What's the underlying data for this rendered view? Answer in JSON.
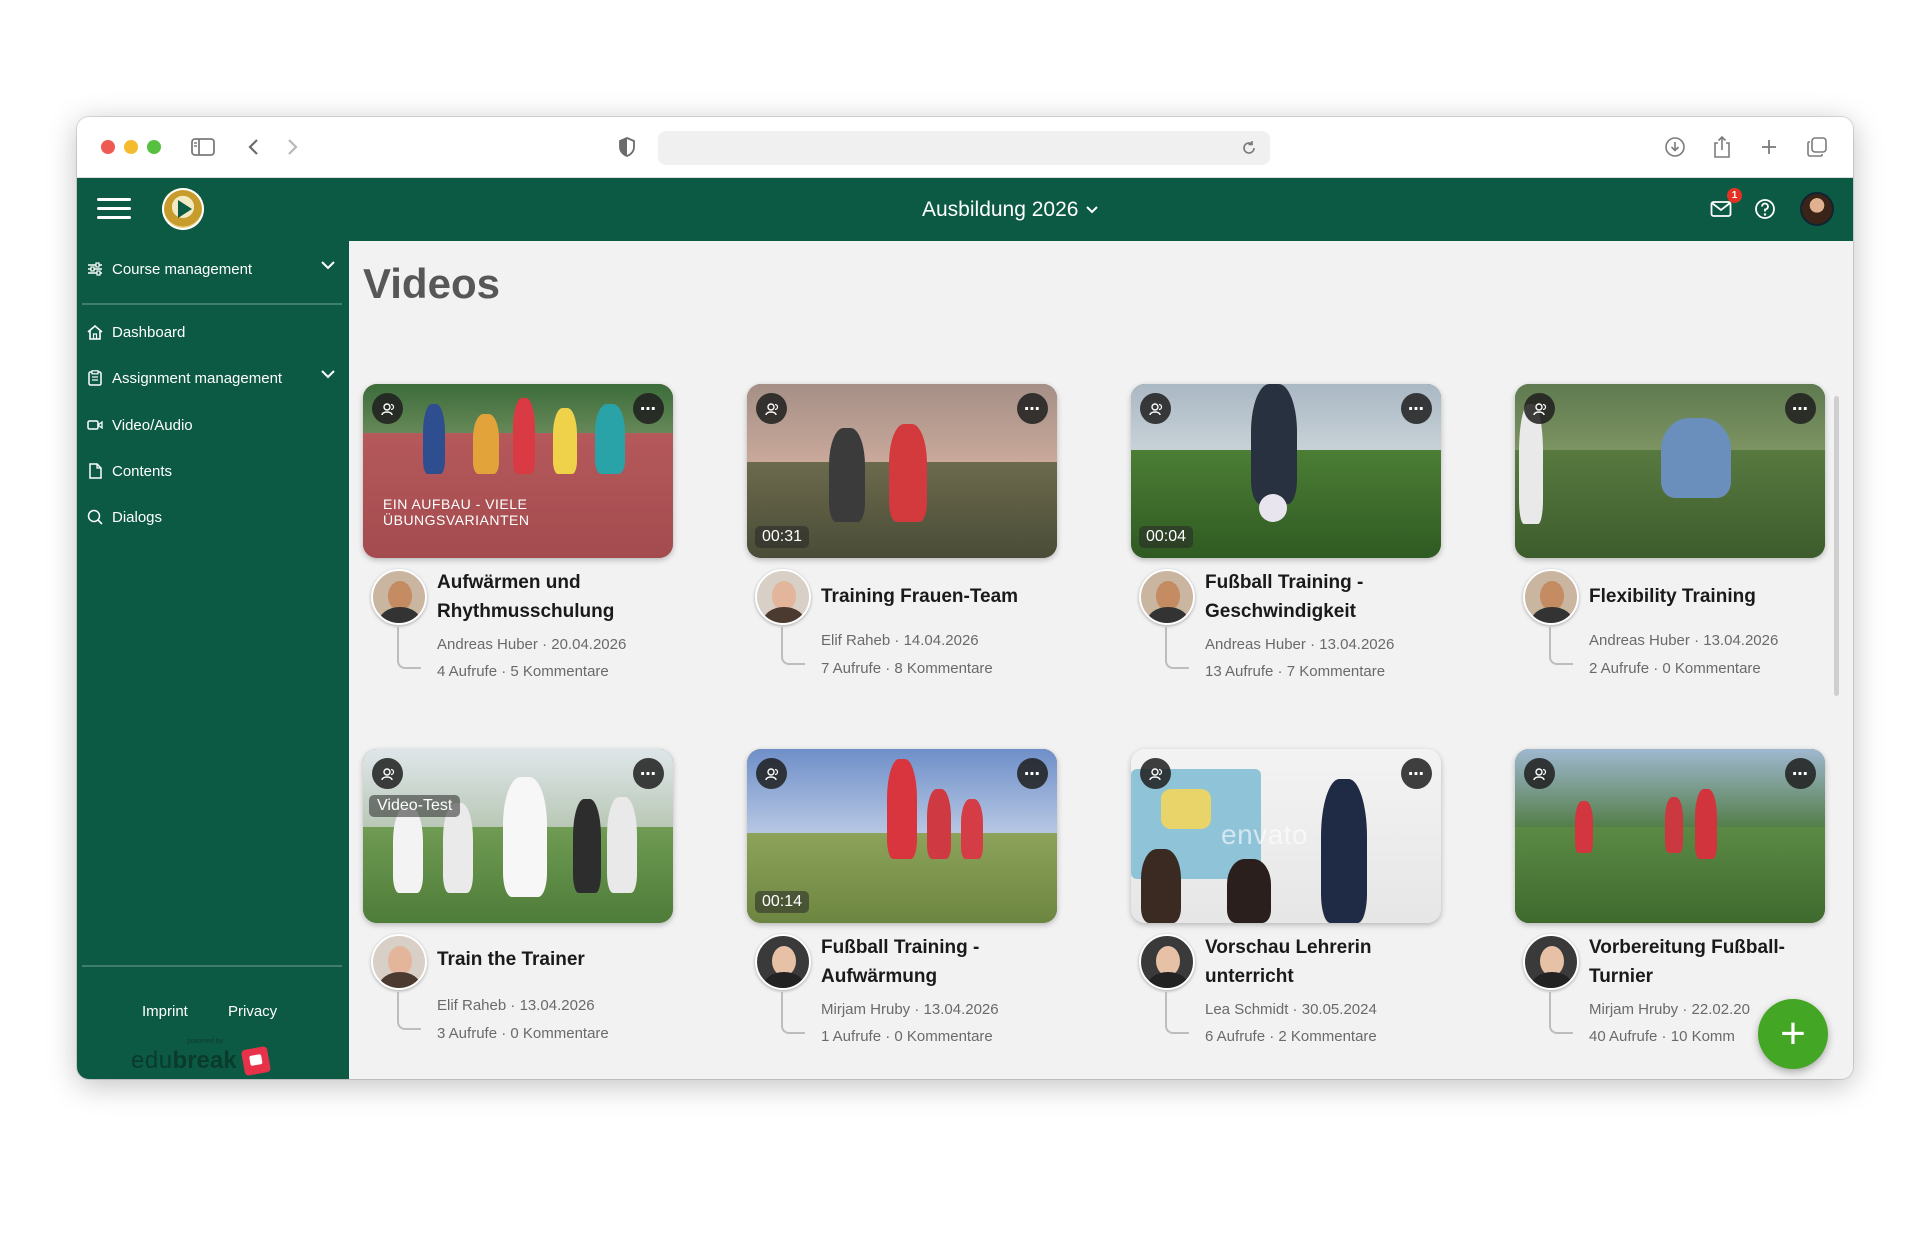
{
  "header": {
    "course": "Ausbildung 2026",
    "notification_count": "1"
  },
  "sidebar": {
    "items": [
      {
        "label": "Course management",
        "icon": "sliders-icon"
      },
      {
        "label": "Dashboard",
        "icon": "home-icon"
      },
      {
        "label": "Assignment management",
        "icon": "clipboard-icon"
      },
      {
        "label": "Video/Audio",
        "icon": "video-icon"
      },
      {
        "label": "Contents",
        "icon": "document-icon"
      },
      {
        "label": "Dialogs",
        "icon": "chat-icon"
      }
    ],
    "footer": {
      "imprint": "Imprint",
      "privacy": "Privacy",
      "powered": "powered by",
      "brand_light": "edu",
      "brand_bold": "break"
    }
  },
  "main": {
    "title": "Videos",
    "videos": [
      {
        "title": "Aufwärmen und Rhythmusschulung",
        "author": "Andreas Huber",
        "date": "20.04.2026",
        "views": "4 Aufrufe",
        "comments": "5 Kommentare",
        "duration": "",
        "tag": "",
        "overlay": "EIN AUFBAU - VIELE ÜBUNGSVARIANTEN"
      },
      {
        "title": "Training Frauen-Team",
        "author": "Elif Raheb",
        "date": "14.04.2026",
        "views": "7 Aufrufe",
        "comments": "8 Kommentare",
        "duration": "00:31",
        "tag": "",
        "overlay": ""
      },
      {
        "title": "Fußball Training - Geschwindigkeit",
        "author": "Andreas Huber",
        "date": "13.04.2026",
        "views": "13 Aufrufe",
        "comments": "7 Kommentare",
        "duration": "00:04",
        "tag": "",
        "overlay": ""
      },
      {
        "title": "Flexibility Training",
        "author": "Andreas Huber",
        "date": "13.04.2026",
        "views": "2 Aufrufe",
        "comments": "0 Kommentare",
        "duration": "",
        "tag": "",
        "overlay": ""
      },
      {
        "title": "Train the Trainer",
        "author": "Elif Raheb",
        "date": "13.04.2026",
        "views": "3 Aufrufe",
        "comments": "0 Kommentare",
        "duration": "",
        "tag": "Video-Test",
        "overlay": ""
      },
      {
        "title": "Fußball Training - Aufwärmung",
        "author": "Mirjam Hruby",
        "date": "13.04.2026",
        "views": "1 Aufrufe",
        "comments": "0 Kommentare",
        "duration": "00:14",
        "tag": "",
        "overlay": ""
      },
      {
        "title": "Vorschau Lehrerin unterricht",
        "author": "Lea Schmidt",
        "date": "30.05.2024",
        "views": "6 Aufrufe",
        "comments": "2 Kommentare",
        "duration": "",
        "tag": "",
        "overlay": "envato"
      },
      {
        "title": "Vorbereitung Fußball-Turnier",
        "author": "Mirjam Hruby",
        "date": "22.02.20",
        "views": "40 Aufrufe",
        "comments": "10 Komm",
        "duration": "",
        "tag": "",
        "overlay": ""
      }
    ]
  },
  "fab": {
    "label": "+"
  }
}
